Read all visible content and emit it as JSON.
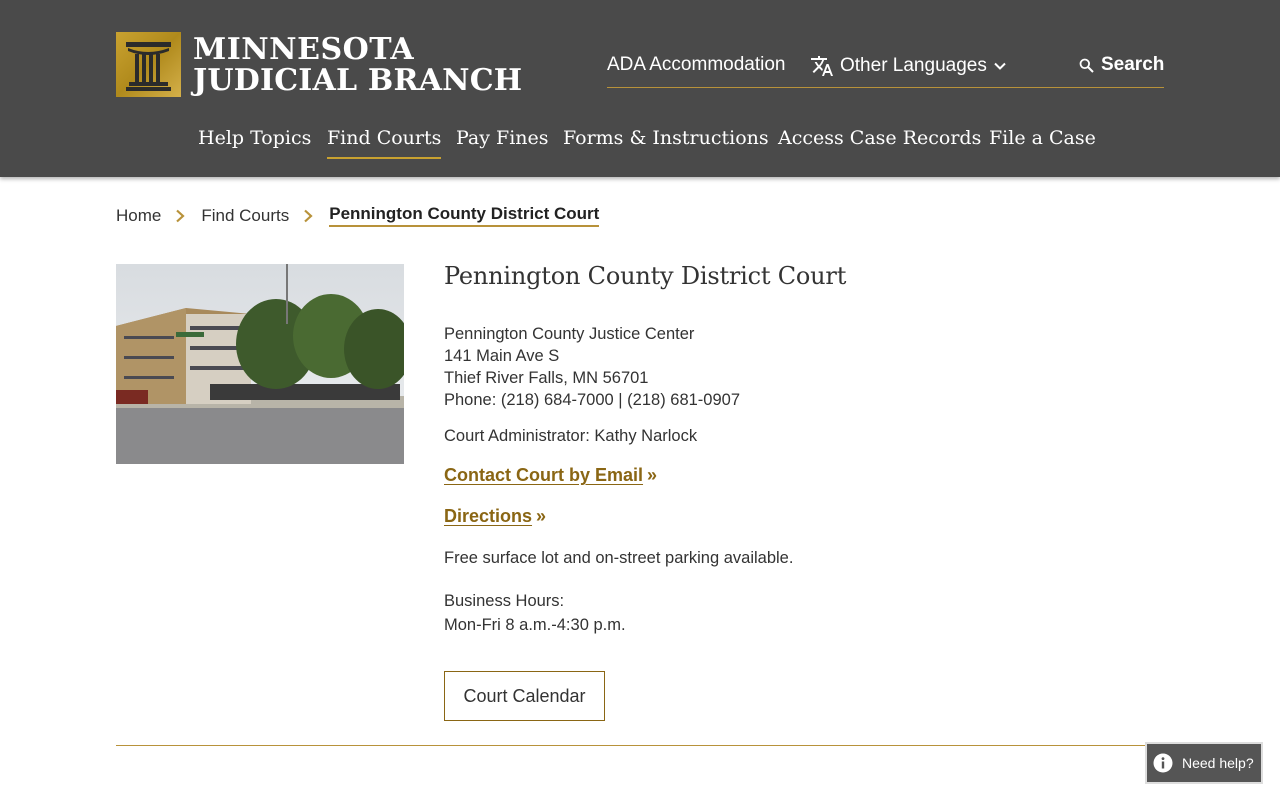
{
  "header": {
    "logo_line1": "MINNESOTA",
    "logo_line2": "JUDICIAL BRANCH",
    "utility": {
      "ada": "ADA Accommodation",
      "languages": "Other Languages",
      "search": "Search"
    },
    "nav": [
      {
        "label": "Help Topics",
        "active": false
      },
      {
        "label": "Find Courts",
        "active": true
      },
      {
        "label": "Pay Fines",
        "active": false
      },
      {
        "label": "Forms & Instructions",
        "active": false
      },
      {
        "label": "Access Case Records",
        "active": false
      },
      {
        "label": "File a Case",
        "active": false
      }
    ]
  },
  "breadcrumb": {
    "items": [
      "Home",
      "Find Courts"
    ],
    "current": "Pennington County District Court"
  },
  "court": {
    "title": "Pennington County District Court",
    "address_lines": [
      "Pennington County Justice Center",
      "141 Main Ave S",
      "Thief River Falls, MN 56701",
      "Phone: (218) 684-7000 | (218) 681-0907"
    ],
    "administrator": "Court Administrator: Kathy Narlock",
    "contact_link": "Contact Court by Email",
    "directions_link": "Directions",
    "link_suffix": "»",
    "parking": "Free surface lot and on-street parking available.",
    "hours_label": "Business Hours:",
    "hours_value": "Mon-Fri 8 a.m.-4:30 p.m.",
    "calendar_button": "Court Calendar"
  },
  "help_widget": {
    "label": "Need help?"
  },
  "colors": {
    "header_bg": "#4a4a4a",
    "accent_gold": "#b8923a",
    "link_gold": "#8a6614"
  },
  "icons": {
    "language": "translate-icon",
    "dropdown": "chevron-down-icon",
    "search": "search-icon",
    "breadcrumb_sep": "chevron-right-icon",
    "help": "info-icon"
  }
}
